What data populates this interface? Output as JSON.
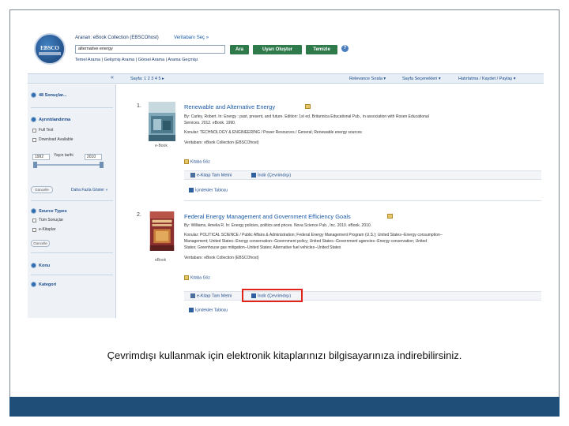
{
  "header": {
    "logo_text": "EBSCO",
    "search_label": "Aranan: eBook Collection (EBSCOhost)",
    "db_link": "Veritabanı Seç »",
    "search_value": "alternative energy",
    "buttons": {
      "search": "Ara",
      "alert": "Uyarı Oluştur",
      "clear": "Temizle"
    },
    "help_icon": "?",
    "adv_links": "Temel Arama | Gelişmiş Arama | Görsel Arama | Arama Geçmişi"
  },
  "navbar": {
    "collapse": "«",
    "pages_label": "Sayfa: 1 2 3 4 5 ▸",
    "sort": "Relevance Sırala ▾",
    "page_options": "Sayfa Seçenekleri ▾",
    "share": "Hatırlatma / Kaydet / Paylaş ▾"
  },
  "sidebar": {
    "results": "48 Sonuçlar...",
    "refine": "Ayrıntılandırma",
    "fulltext": "Full Text",
    "downloadable": "Download Available",
    "year_label": "Yayın tarihi",
    "year_from": "1992",
    "year_to": "2010",
    "update_btn": "Güncelle",
    "more": "Daha Fazla Göster »",
    "source_types": "Source Types",
    "all_results": "Tüm Sonuçlar",
    "ebooks": "e-Kitaplar",
    "update_btn2": "Güncelle",
    "subject": "Konu",
    "category": "Kategori"
  },
  "results": [
    {
      "num": "1.",
      "title": "Renewable and Alternative Energy",
      "line1": "By: Carley, Robert. In: Energy : past, present, and future. Edition: 1st ed. Britannica Educational Pub., in association with Rosen Educational",
      "line2": "Services. 2012. eBook. 1990.",
      "line3": "Konular: TECHNOLOGY & ENGINEERING / Power Resources / General; Renewable energy sources",
      "line4": "Veritabanı: eBook Collection (EBSCOhost)",
      "view": "Kitaba Göz",
      "fulltext": "e-Kitap Tam Metni",
      "download": "İndir (Çevrimdışı)",
      "toc": "İçindekiler Tablosu",
      "thumb_caption": "e-Book"
    },
    {
      "num": "2.",
      "title": "Federal Energy Management and Government Efficiency Goals",
      "line1": "By: Williams, Amelia R. In: Energy policies, politics and prices. Nova Science Pub., Inc. 2010. eBook. 2010.",
      "line2": "Konular: POLITICAL SCIENCE / Public Affairs & Administration; Federal Energy Management Program (U.S.); United States--Energy consumption--",
      "line3": "Management; United States--Energy conservation--Government policy; United States--Government agencies--Energy conservation; United",
      "line4": "States; Greenhouse gas mitigation--United States; Alternative fuel vehicles--United States",
      "line5": "Veritabanı: eBook Collection (EBSCOhost)",
      "view": "Kitaba Göz",
      "fulltext": "e-Kitap Tam Metni",
      "download": "İndir (Çevrimdışı)",
      "toc": "İçindekiler Tablosu",
      "thumb_caption": "eBook"
    }
  ],
  "caption": "Çevrimdışı kullanmak için elektronik kitaplarınızı bilgisayarınıza indirebilirsiniz.",
  "colors": {
    "accent": "#1f4e79",
    "highlight": "#e2231a",
    "button": "#2f7a4a"
  }
}
